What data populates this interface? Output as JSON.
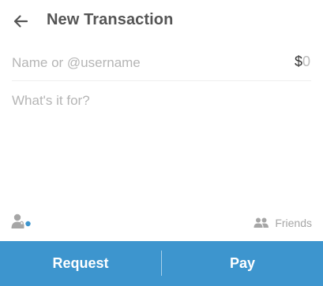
{
  "header": {
    "back_icon": "arrow-left-icon",
    "title": "New Transaction"
  },
  "form": {
    "recipient_placeholder": "Name or @username",
    "recipient_value": "",
    "amount_currency": "$",
    "amount_value": "0",
    "note_placeholder": "What's it for?",
    "note_value": ""
  },
  "footer_tools": {
    "contacts_icon": "person-lock-icon",
    "privacy_icon": "people-icon",
    "privacy_label": "Friends"
  },
  "actions": {
    "request_label": "Request",
    "pay_label": "Pay"
  },
  "colors": {
    "accent": "#3d95ce",
    "title_text": "#555555",
    "placeholder_text": "#b5b5b5",
    "muted_icon": "#a6a6a6"
  }
}
